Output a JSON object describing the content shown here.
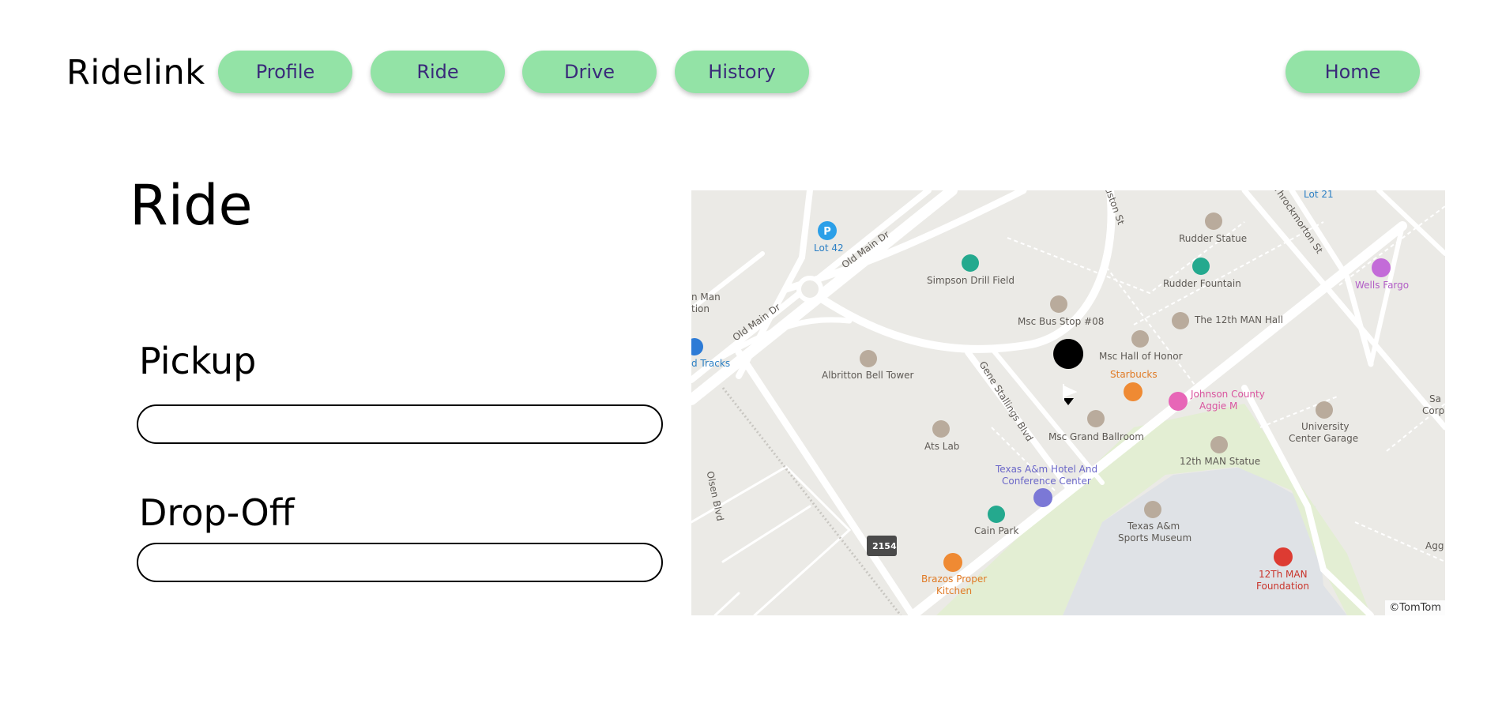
{
  "app": {
    "brand": "Ridelink"
  },
  "nav": {
    "items": [
      {
        "label": "Profile"
      },
      {
        "label": "Ride"
      },
      {
        "label": "Drive"
      },
      {
        "label": "History"
      }
    ],
    "home_label": "Home"
  },
  "page": {
    "title": "Ride",
    "pickup_label": "Pickup",
    "pickup_value": "",
    "dropoff_label": "Drop-Off",
    "dropoff_value": ""
  },
  "map": {
    "credit": "©TomTom",
    "labels": {
      "lot42": "Lot 42",
      "old_main_dr_a": "Old Main Dr",
      "old_main_dr_b": "Old Main Dr",
      "simpson": "Simpson Drill Field",
      "rudder_statue": "Rudder Statue",
      "rudder_fountain": "Rudder Fountain",
      "wells_fargo": "Wells Fargo",
      "lot21": "Lot 21",
      "throckmorton": "Throckmorton St",
      "houston": "Houston St",
      "msc_bus": "Msc Bus Stop #08",
      "twelfth_hall": "The 12th MAN Hall",
      "msc_honor": "Msc Hall of Honor",
      "starbucks": "Starbucks",
      "johnson_1": "Johnson County",
      "johnson_2": "Aggie M",
      "univ_garage_1": "University",
      "univ_garage_2": "Center Garage",
      "albritton": "Albritton Bell Tower",
      "gene_stallings": "Gene Stallings Blvd",
      "msc_ballroom": "Msc Grand Ballroom",
      "ats_lab": "Ats Lab",
      "hotel_1": "Texas A&m Hotel And",
      "hotel_2": "Conference Center",
      "twelfth_statue": "12th MAN Statue",
      "sports_1": "Texas A&m",
      "sports_2": "Sports Museum",
      "cain_park": "Cain Park",
      "brazos_1": "Brazos Proper",
      "brazos_2": "Kitchen",
      "foundation_1": "12Th MAN",
      "foundation_2": "Foundation",
      "olsen": "Olsen Blvd",
      "tracks": "d Tracks",
      "man_1": "n Man",
      "man_2": "tion",
      "corp": "Corp",
      "agg": "Agg",
      "sa": "Sa",
      "route": "2154"
    },
    "colors": {
      "land": "#ebeae6",
      "road": "#ffffff",
      "water": "#dfe2e6",
      "park": "#e3eed3",
      "poi_gray": "#b9ab9c",
      "poi_green": "#24a98e",
      "poi_orange": "#ef8a33",
      "poi_pink": "#e766b7",
      "poi_purple": "#c36bd8",
      "poi_red": "#dd3b32",
      "poi_blue": "#7b78d6",
      "parking": "#2b9fe8",
      "marker": "#000000",
      "nav_bg": "#93e3a6",
      "nav_text": "#3a2a7a"
    }
  }
}
